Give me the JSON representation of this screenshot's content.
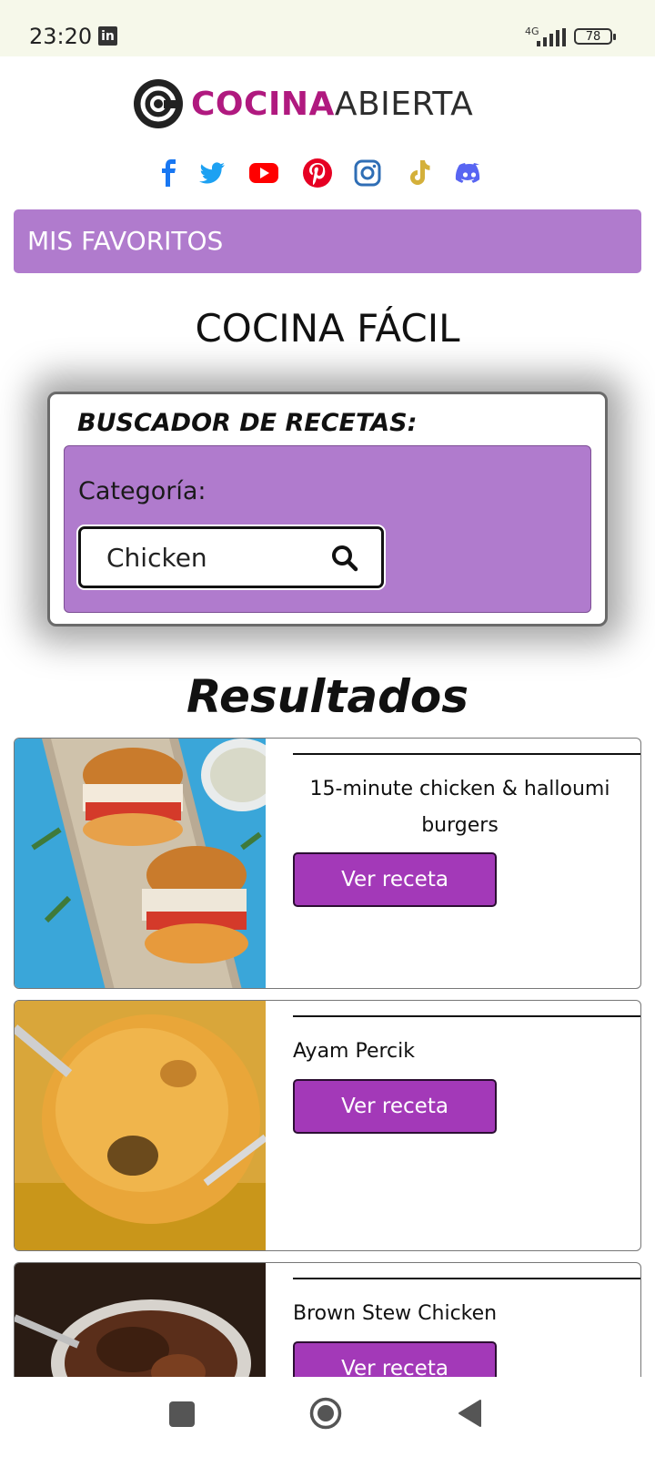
{
  "status_bar": {
    "time": "23:20",
    "notification_icon": "linkedin-icon",
    "network": "4G",
    "battery": "78"
  },
  "brand": {
    "name_part1": "COCINA",
    "name_part2": "ABIERTA",
    "accent": "#b0197f"
  },
  "social": [
    {
      "name": "facebook-icon",
      "color": "#1877f2"
    },
    {
      "name": "twitter-icon",
      "color": "#1da1f2"
    },
    {
      "name": "youtube-icon",
      "color": "#ff0000"
    },
    {
      "name": "pinterest-icon",
      "color": "#e60023"
    },
    {
      "name": "instagram-icon",
      "color": "#2f6eb5"
    },
    {
      "name": "tiktok-icon",
      "color": "#d4b03a"
    },
    {
      "name": "discord-icon",
      "color": "#5865f2"
    }
  ],
  "favorites_label": "MIS FAVORITOS",
  "page_title": "COCINA FÁCIL",
  "search": {
    "title": "BUSCADOR DE RECETAS:",
    "category_label": "Categoría:",
    "category_value": "Chicken"
  },
  "results_title": "Resultados",
  "results": [
    {
      "name": "15-minute chicken & halloumi burgers",
      "button": "Ver receta"
    },
    {
      "name": "Ayam Percik",
      "button": "Ver receta"
    },
    {
      "name": "Brown Stew Chicken",
      "button": "Ver receta"
    }
  ],
  "colors": {
    "panel_purple": "#b07bcd",
    "button_purple": "#a339b8"
  }
}
